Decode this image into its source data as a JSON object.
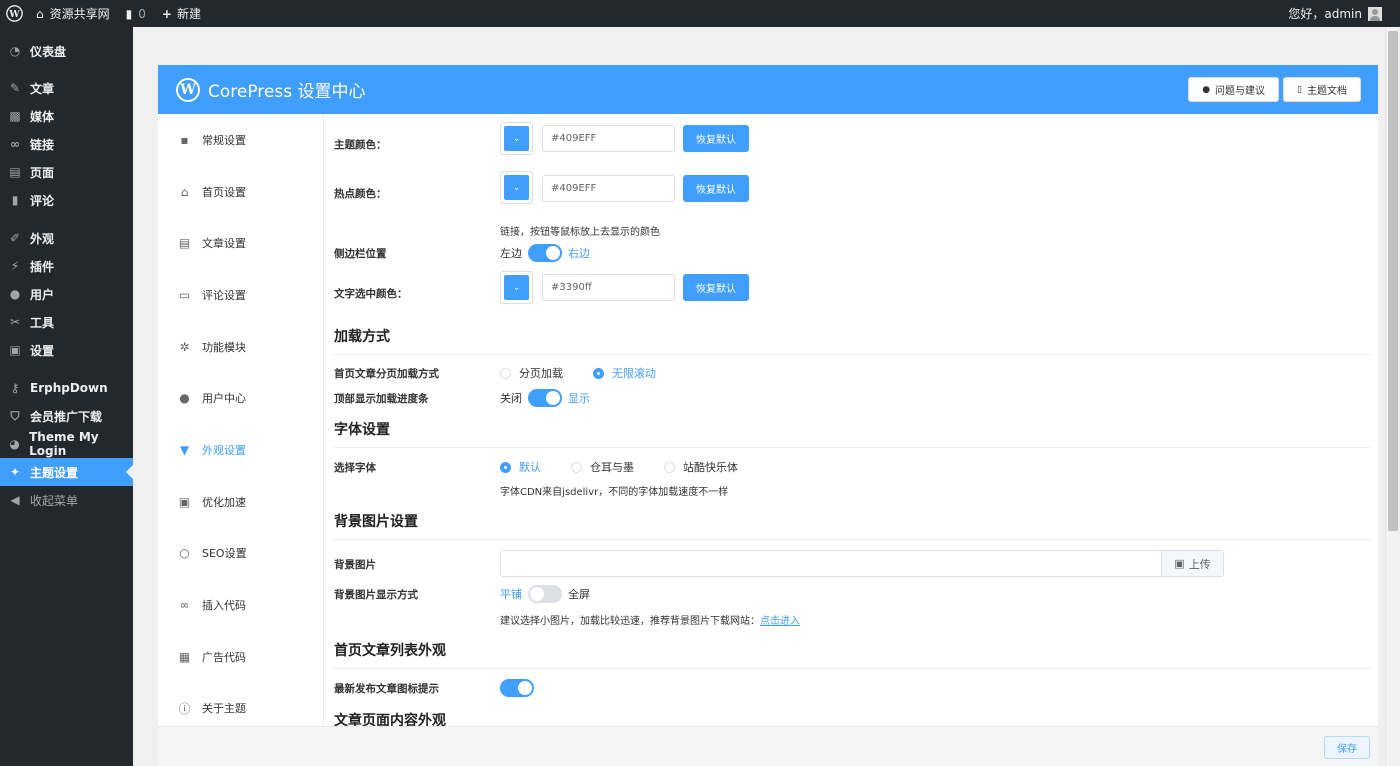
{
  "adminbar": {
    "site_name": "资源共享网",
    "comments_count": "0",
    "new_label": "新建",
    "greeting": "您好，admin"
  },
  "admin_menu": [
    {
      "label": "仪表盘",
      "icon": "dashboard-icon"
    },
    {
      "label": "文章",
      "icon": "pin-icon"
    },
    {
      "label": "媒体",
      "icon": "media-icon"
    },
    {
      "label": "链接",
      "icon": "link-icon"
    },
    {
      "label": "页面",
      "icon": "page-icon"
    },
    {
      "label": "评论",
      "icon": "comment-icon"
    },
    {
      "label": "外观",
      "icon": "brush-icon"
    },
    {
      "label": "插件",
      "icon": "plugin-icon"
    },
    {
      "label": "用户",
      "icon": "user-icon"
    },
    {
      "label": "工具",
      "icon": "wrench-icon"
    },
    {
      "label": "设置",
      "icon": "settings-icon"
    },
    {
      "label": "ErphpDown",
      "icon": "key-icon"
    },
    {
      "label": "会员推广下载",
      "icon": "shield-icon"
    },
    {
      "label": "Theme My Login",
      "icon": "user-circle-icon"
    },
    {
      "label": "主题设置",
      "icon": "theme-icon"
    },
    {
      "label": "收起菜单",
      "icon": "collapse-icon"
    }
  ],
  "panel": {
    "title": "CorePress 设置中心",
    "logo_letter": "W",
    "btn_feedback": "问题与建议",
    "btn_docs": "主题文档"
  },
  "side_menu": [
    {
      "label": "常规设置",
      "icon": "grid-icon",
      "glyph": "▪"
    },
    {
      "label": "首页设置",
      "icon": "home-icon",
      "glyph": "⌂"
    },
    {
      "label": "文章设置",
      "icon": "document-icon",
      "glyph": "▤"
    },
    {
      "label": "评论设置",
      "icon": "comment-icon",
      "glyph": "▭"
    },
    {
      "label": "功能模块",
      "icon": "gear-icon",
      "glyph": "✲"
    },
    {
      "label": "用户中心",
      "icon": "user-icon",
      "glyph": "●"
    },
    {
      "label": "外观设置",
      "icon": "brush-icon",
      "glyph": "▼"
    },
    {
      "label": "优化加速",
      "icon": "chart-icon",
      "glyph": "▣"
    },
    {
      "label": "SEO设置",
      "icon": "search-icon",
      "glyph": "○"
    },
    {
      "label": "插入代码",
      "icon": "link-icon",
      "glyph": "∞"
    },
    {
      "label": "广告代码",
      "icon": "clipboard-icon",
      "glyph": "▦"
    },
    {
      "label": "关于主题",
      "icon": "info-icon",
      "glyph": "ⓘ"
    }
  ],
  "settings": {
    "theme_color_label": "主题颜色：",
    "theme_color_value": "#409EFF",
    "hot_color_label": "热点颜色：",
    "hot_color_value": "#409EFF",
    "hot_color_hint": "链接，按钮等鼠标放上去显示的颜色",
    "sidebar_pos_label": "侧边栏位置",
    "sidebar_left": "左边",
    "sidebar_right": "右边",
    "select_color_label": "文字选中颜色：",
    "select_color_value": "#3390ff",
    "reset_label": "恢复默认",
    "loading_section": "加载方式",
    "paging_label": "首页文章分页加载方式",
    "paging_opt1": "分页加载",
    "paging_opt2": "无限滚动",
    "progress_label": "顶部显示加载进度条",
    "progress_off": "关闭",
    "progress_on": "显示",
    "font_section": "字体设置",
    "font_label": "选择字体",
    "font_opt1": "默认",
    "font_opt2": "仓耳与墨",
    "font_opt3": "站酷快乐体",
    "font_hint": "字体CDN来自jsdelivr，不同的字体加载速度不一样",
    "bg_section": "背景图片设置",
    "bg_label": "背景图片",
    "upload_label": "上传",
    "bg_mode_label": "背景图片显示方式",
    "bg_mode_tile": "平铺",
    "bg_mode_full": "全屏",
    "bg_hint": "建议选择小图片，加载比较迅速，推荐背景图片下载网站：",
    "bg_hint_link": "点击进入",
    "list_section": "首页文章列表外观",
    "new_post_label": "最新发布文章图标提示",
    "article_section": "文章页面内容外观"
  },
  "footer": {
    "save_label": "保存"
  },
  "colors": {
    "accent": "#409eff",
    "admin_dark": "#23282d"
  }
}
